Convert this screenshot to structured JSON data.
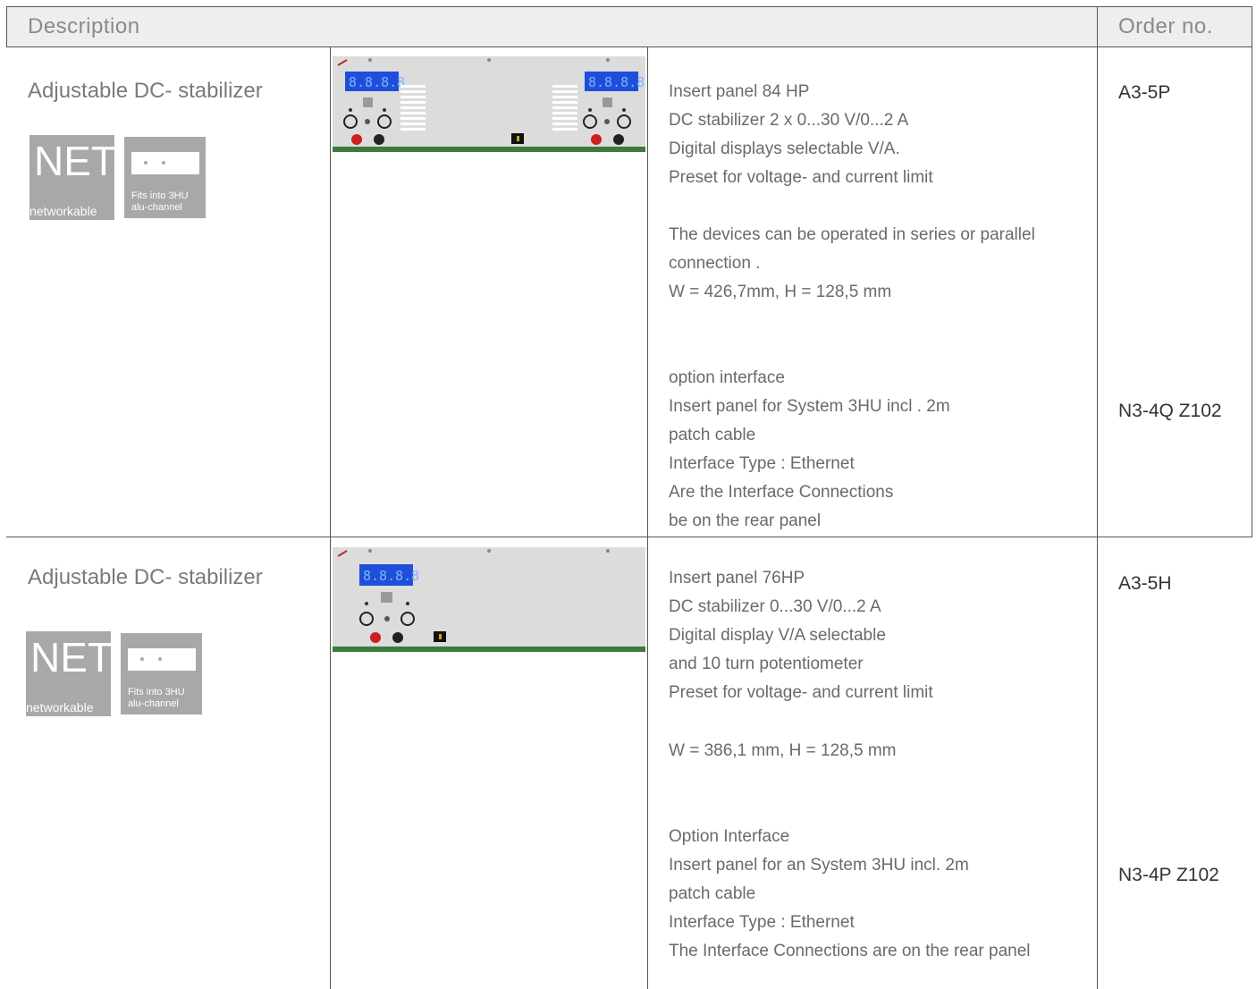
{
  "header": {
    "description": "Description",
    "order_no": "Order no."
  },
  "rows": [
    {
      "title": "Adjustable DC- stabilizer",
      "badge_net": {
        "big": "NET",
        "small": "networkable"
      },
      "badge_fit": {
        "line1": "Fits into 3HU",
        "line2": "alu-channel"
      },
      "description": [
        "Insert panel  84 HP",
        "DC stabilizer 2 x 0...30 V/0...2 A",
        "Digital displays selectable V/A.",
        "Preset for voltage- and current limit",
        "",
        "The devices can be operated in series or parallel",
        "connection .",
        "W = 426,7mm, H = 128,5 mm",
        "",
        "",
        "option interface",
        "Insert panel for System 3HU incl . 2m",
        "patch cable",
        "Interface Type : Ethernet",
        "Are the Interface Connections",
        "be  on the rear panel"
      ],
      "order_main": "A3-5P",
      "order_option": "N3-4Q  Z102"
    },
    {
      "title": "Adjustable DC- stabilizer",
      "badge_net": {
        "big": "NET",
        "small": "networkable"
      },
      "badge_fit": {
        "line1": "Fits into 3HU",
        "line2": "alu-channel"
      },
      "description": [
        "Insert panel  76HP",
        "DC stabilizer 0...30 V/0...2 A",
        "Digital display V/A selectable",
        "and 10 turn potentiometer",
        "Preset for voltage- and current limit",
        "",
        "W = 386,1 mm, H = 128,5 mm",
        "",
        "",
        "Option Interface",
        "Insert panel for an System 3HU incl. 2m",
        "patch cable",
        "Interface Type : Ethernet",
        "The Interface Connections are on the rear panel"
      ],
      "order_main": "A3-5H",
      "order_option": "N3-4P  Z102"
    }
  ],
  "display_text": "8.8.8.8",
  "colors": {
    "display": "#1d4fd8",
    "panel": "#dcdcdc",
    "panel_bar": "#3d7a3d",
    "badge": "#a8a8a8"
  }
}
